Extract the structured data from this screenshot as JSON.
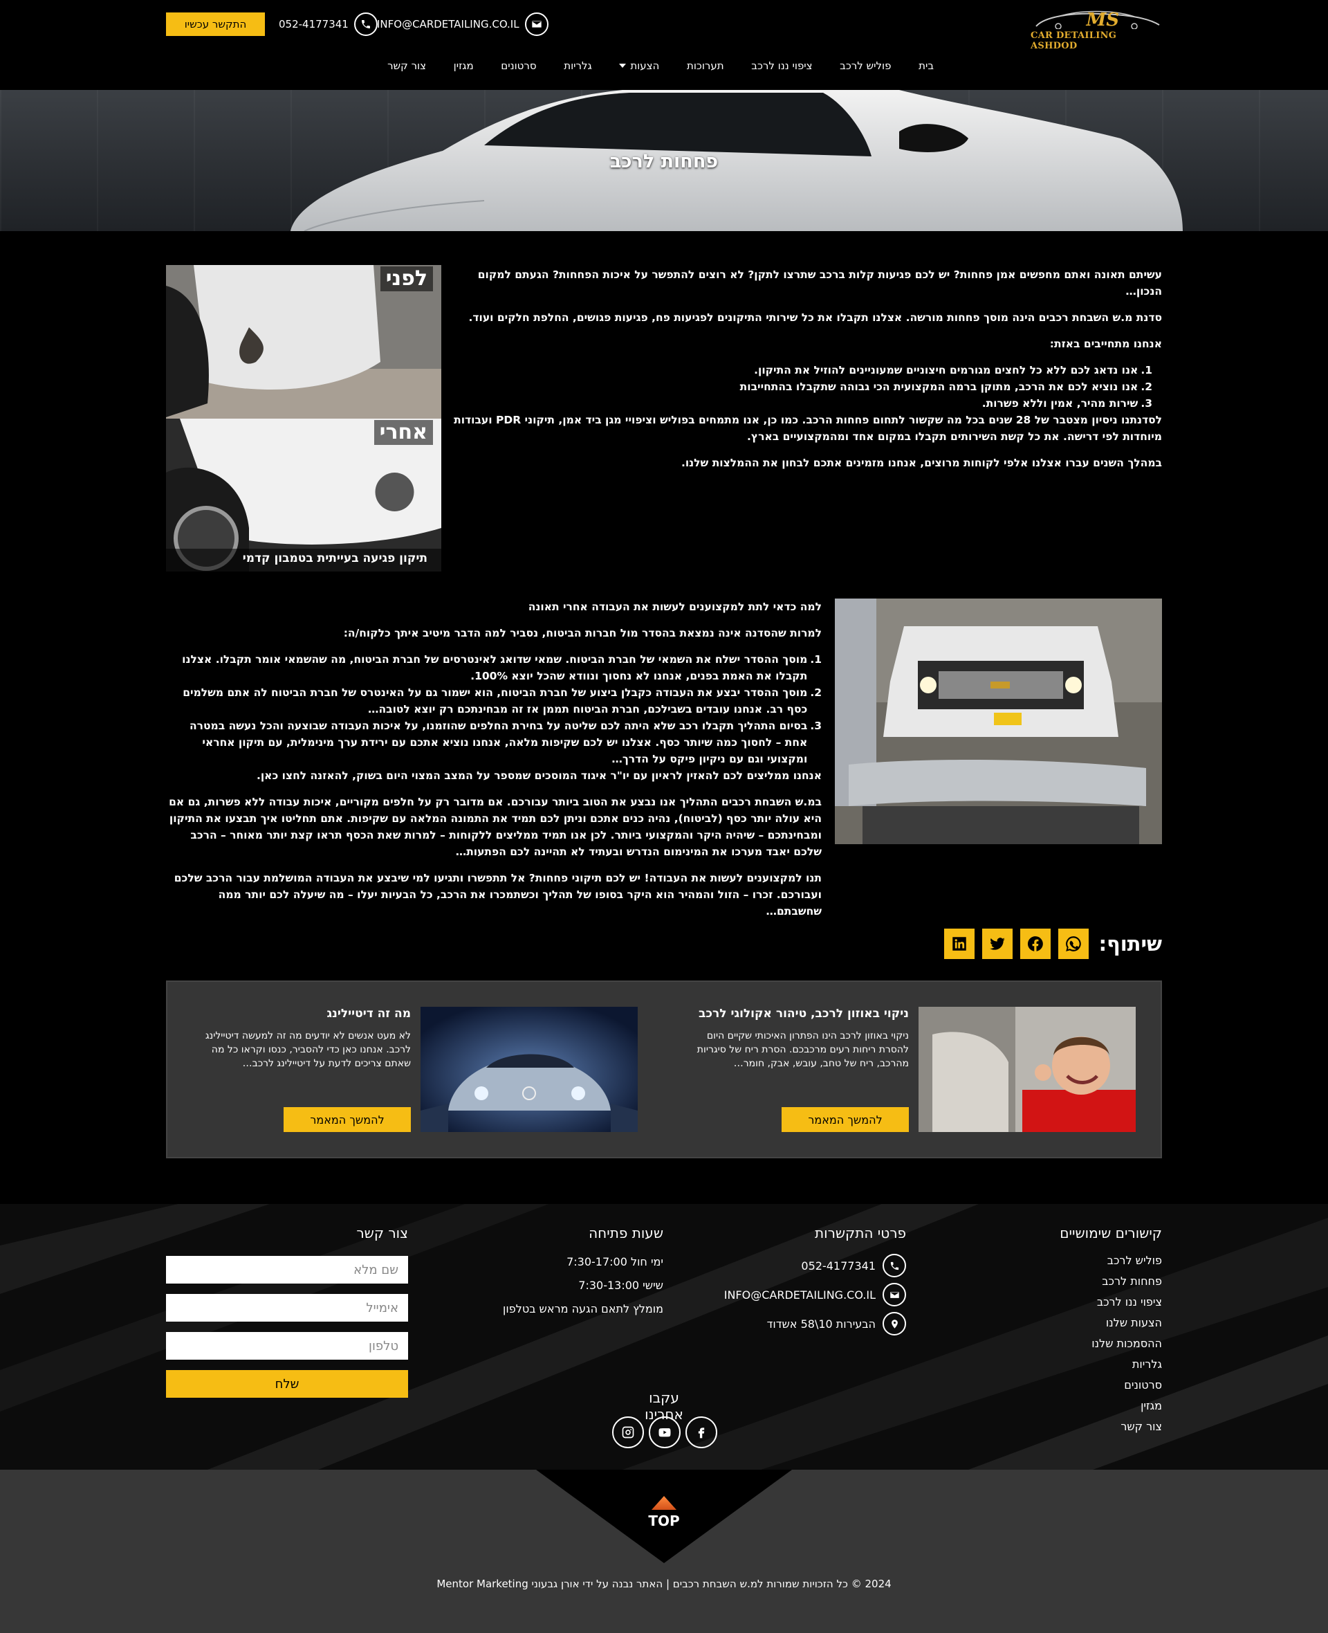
{
  "header": {
    "logo_text": "MS",
    "logo_sub": "CAR DETAILING ASHDOD",
    "cta": "התקשר עכשיו",
    "phone": "052-4177341",
    "email": "INFO@CARDETAILING.CO.IL",
    "nav": [
      "בית",
      "פוליש לרכב",
      "ציפוי ננו לרכב",
      "תערוכות",
      "הצעות",
      "גלריות",
      "סרטונים",
      "מגזין",
      "צור קשר"
    ]
  },
  "hero": {
    "title": "פחחות לרכב"
  },
  "section1": {
    "p1": "עשיתם תאונה ואתם מחפשים אמן פחחות? יש לכם פגיעות קלות ברכב שתרצו לתקן? לא רוצים להתפשר על איכות הפחחות? הגעתם למקום הנכון…",
    "p2": "סדנת מ.ש השבחת רכבים הינה מוסך פחחות מורשה. אצלנו תקבלו את כל שירותי התיקונים לפגיעות פח, פגיעות פגושים, החלפת חלקים ועוד.",
    "p3": "אנחנו מתחייבים באזת:",
    "list": [
      {
        "n": "1.",
        "t": "אנו נדאג לכם ללא כל לחצים מגורמים חיצוניים שמעוניינים להוזיל את התיקון."
      },
      {
        "n": "2.",
        "t": "אנו נוציא לכם את הרכב, מתוקן ברמה המקצועית הכי גבוהה שתקבלו בהתחייבות"
      },
      {
        "n": "3.",
        "t": "שירות מהיר, אמין וללא פשרות."
      }
    ],
    "p4": "לסדנתנו ניסיון מצטבר של 28 שנים בכל מה שקשור לתחום פחחות הרכב. כמו כן, אנו מתמחים בפוליש וציפויי מגן ביד אמן, תיקוני PDR ועבודות מיוחדות לפי דרישה. את כל קשת השירותים תקבלו במקום אחד ומהמקצועיים בארץ.",
    "p5": "במהלך השנים עברו אצלנו אלפי לקוחות מרוצים, אנחנו מזמינים אתכם לבחון את ההמלצות שלנו.",
    "img_before": "לפני",
    "img_after": "אחרי",
    "img_caption": "תיקון פגיעה בעייתית בטמבון קדמי"
  },
  "section2": {
    "title": "למה כדאי לתת למקצוענים לעשות את העבודה אחרי תאונה",
    "intro": "למרות שהסדנה אינה נמצאת בהסדר מול חברות הביטוח, נסביר למה הדבר מיטיב איתך כלקוח/ה:",
    "list": [
      {
        "n": "1.",
        "t": "מוסך ההסדר ישלח את השמאי של חברת הביטוח. שמאי שדואג לאינטרסים של חברת הביטוח, מה שהשמאי אומר תקבלו. אצלנו תקבלו את האמת בפנים, אנחנו לא נחסוך ונוודא שהכל יוצא 100%."
      },
      {
        "n": "2.",
        "t": "מוסך ההסדר יבצע את העבודה כקבלן ביצוע של חברת הביטוח, הוא ישמור גם על האינטרס של חברת הביטוח לה אתם משלמים כסף רב. אנחנו עובדים בשבילכם, חברת הביטוח תממן אז זה מבחינתכם רק יוצא לטובה…"
      },
      {
        "n": "3.",
        "t": "בסיום התהליך תקבלו רכב שלא היתה לכם שליטה על בחירת החלפים שהוזמנו, על איכות העבודה שבוצעה והכל נעשה במטרה אחת – לחסוך כמה שיותר כסף. אצלנו יש לכם שקיפות מלאה, אנחנו נוציא אתכם עם ירידת ערך מינימלית, עם תיקון אחראי ומקצועי וגם עם ניקיון פיקס על הדרך…"
      }
    ],
    "after_list": "אנחנו ממליצים לכם להאזין לראיון עם יו\"ר איגוד המוסכים שמספר על המצב המצוי היום בשוק, להאזנה לחצו כאן.",
    "p1": "במ.ש השבחת רכבים התהליך אנו נבצע את הטוב ביותר עבורכם. אם מדובר רק על חלפים מקוריים, איכות עבודה ללא פשרות, גם אם היא עולה יותר כסף (לביטוח), נהיה כנים אתכם וניתן לכם תמיד את התמונה המלאה עם שקיפות. אתם תחליטו איך תבצעו את התיקון ומבחינתכם – שיהיה היקר והמקצועי ביותר. לכן אנו תמיד ממליצים ללקוחות – למרות שאת הכסף תראו קצת יותר מאוחר – הרכב שלכם יאבד מערכו את המינימום הנדרש ובעתיד לא תהיינה לכם הפתעות…",
    "p2": "תנו למקצוענים לעשות את העבודה! יש לכם תיקוני פחחות? אל תתפשרו ותגיעו למי שיבצע את העבודה המושלמת עבור הרכב שלכם ועבורכם. זכרו – הזול והמהיר הוא היקר בסופו של תהליך וכשתמכרו את הרכב, כל הבעיות יעלו – מה שיעלה לכם יותר ממה שחשבתם…"
  },
  "share": {
    "title": "שיתוף:"
  },
  "related": [
    {
      "title": "ניקוי באוזון לרכב, טיהור אקולוגי לרכב",
      "text": "ניקוי באוזון לרכב הינו הפתרון האיכותי שקיים היום להסרת ריחות רעים מרכבכם. הסרת ריח של סיגריות מהרכב, ריח של טחב, עובש, אבק, חומר…",
      "button": "להמשך המאמר"
    },
    {
      "title": "מה זה דיטיילינג",
      "text": "לא מעט אנשים לא יודעים מה זה למעשה דיטיילינג לרכב. אנחנו כאן כדי להסביר, כנסו וקראו כל מה שאתם צריכים לדעת על דיטיילינג לרכב…",
      "button": "להמשך המאמר"
    }
  ],
  "footer": {
    "links_title": "קישורים שימושיים",
    "links": [
      "פוליש לרכב",
      "פחחות לרכב",
      "ציפוי ננו לרכב",
      "הצעות שלנו",
      "ההסמכות שלנו",
      "גלריות",
      "סרטונים",
      "מגזין",
      "צור קשר"
    ],
    "contact_title": "פרטי התקשרות",
    "phone": "052-4177341",
    "email": "INFO@CARDETAILING.CO.IL",
    "address": "הבעירות 10\\58 אשדוד",
    "hours_title": "שעות פתיחה",
    "hours": [
      "ימי חול 7:30-17:00",
      "שישי 7:30-13:00",
      "מומלץ לתאם הגעה מראש בטלפון"
    ],
    "form_title": "צור קשר",
    "placeholders": [
      "שם מלא",
      "אימייל",
      "טלפון"
    ],
    "send": "שלח",
    "follow": "עקבו אחרינו"
  },
  "bottom": {
    "top_label": "TOP",
    "copyright": "2024 © כל הזכויות שמורות למ.ש השבחת רכבים | האתר נבנה על ידי אורן גבעוני Mentor Marketing"
  },
  "colors": {
    "accent": "#f6bd14",
    "logo": "#e2ac2e",
    "panel": "#363636",
    "footer_bottom": "#373737"
  },
  "icons": [
    "envelope-icon",
    "phone-icon",
    "caret-down-icon",
    "whatsapp-icon",
    "facebook-icon",
    "twitter-icon",
    "linkedin-icon",
    "map-pin-icon",
    "instagram-icon",
    "youtube-icon",
    "arrow-up-icon"
  ]
}
